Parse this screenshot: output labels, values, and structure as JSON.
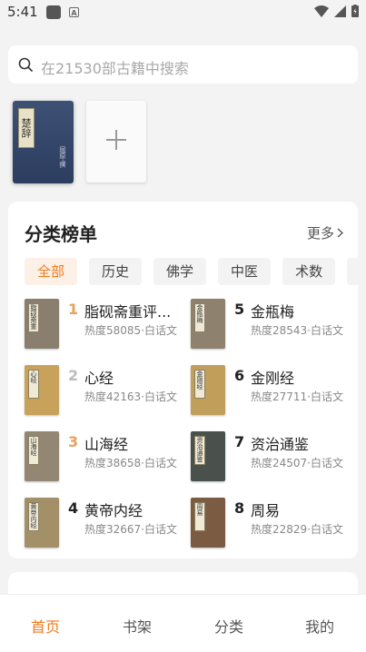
{
  "status_bar": {
    "time": "5:41"
  },
  "search": {
    "placeholder": "在21530部古籍中搜索"
  },
  "shelf": {
    "book": {
      "title": "楚辞",
      "subtitle": "屈原·撰"
    }
  },
  "ranking": {
    "title": "分类榜单",
    "more_label": "更多",
    "categories": [
      "全部",
      "历史",
      "佛学",
      "中医",
      "术数",
      "小"
    ],
    "active_category": "全部",
    "books": [
      {
        "rank": "1",
        "name": "脂砚斋重评...",
        "heat": "热度58085·白话文",
        "cover_label": "脂砚斋重评石头记",
        "cover_color": "#8a7f6e"
      },
      {
        "rank": "2",
        "name": "心经",
        "heat": "热度42163·白话文",
        "cover_label": "心经",
        "cover_color": "#c8a25b"
      },
      {
        "rank": "3",
        "name": "山海经",
        "heat": "热度38658·白话文",
        "cover_label": "山海经",
        "cover_color": "#938774"
      },
      {
        "rank": "4",
        "name": "黄帝内经",
        "heat": "热度32667·白话文",
        "cover_label": "黄帝内经",
        "cover_color": "#a39068"
      },
      {
        "rank": "5",
        "name": "金瓶梅",
        "heat": "热度28543·白话文",
        "cover_label": "金瓶梅",
        "cover_color": "#8e826f"
      },
      {
        "rank": "6",
        "name": "金刚经",
        "heat": "热度27711·白话文",
        "cover_label": "金刚经",
        "cover_color": "#c19f5a"
      },
      {
        "rank": "7",
        "name": "资治通鉴",
        "heat": "热度24507·白话文",
        "cover_label": "资治通鉴",
        "cover_color": "#4a514d"
      },
      {
        "rank": "8",
        "name": "周易",
        "heat": "热度22829·白话文",
        "cover_label": "周易",
        "cover_color": "#7b5c43"
      }
    ]
  },
  "tabbar": {
    "tabs": [
      "首页",
      "书架",
      "分类",
      "我的"
    ],
    "active": "首页"
  },
  "colors": {
    "accent": "#f07a1e",
    "rank_top": "#e8a15b"
  }
}
